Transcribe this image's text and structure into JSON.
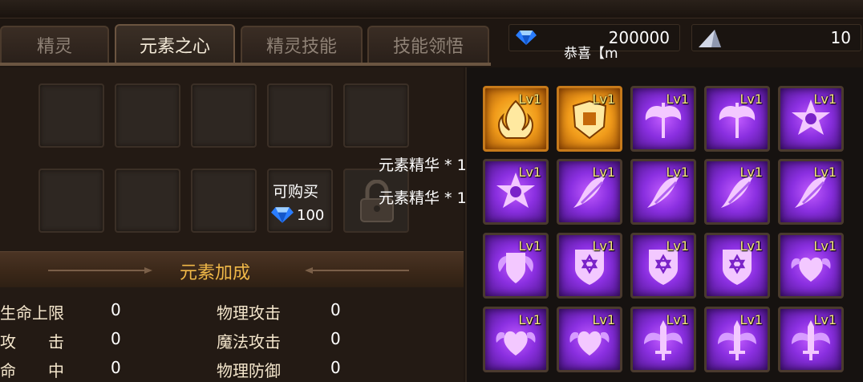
{
  "tabs": [
    {
      "label": "精灵",
      "active": false
    },
    {
      "label": "元素之心",
      "active": true
    },
    {
      "label": "精灵技能",
      "active": false
    },
    {
      "label": "技能领悟",
      "active": false
    }
  ],
  "currency": {
    "diamonds": "200000",
    "crystals": "10"
  },
  "notice": "恭喜【m",
  "shop": {
    "buy_label": "可购买",
    "price": "100"
  },
  "tooltip": [
    "元素精华 * 1",
    "元素精华 * 1"
  ],
  "bonus": {
    "title": "元素加成",
    "stats": [
      {
        "name": "生命上限",
        "value": "0"
      },
      {
        "name": "攻　　击",
        "value": "0"
      },
      {
        "name": "命　　中",
        "value": "0"
      },
      {
        "name": "物理攻击",
        "value": "0"
      },
      {
        "name": "魔法攻击",
        "value": "0"
      },
      {
        "name": "物理防御",
        "value": "0"
      }
    ]
  },
  "skills": {
    "level_label": "Lv1",
    "colors": {
      "gold": "#f09a1a",
      "purple": "#8a2fe0"
    },
    "items": [
      {
        "icon": "flame-crest-icon",
        "rarity": "gold"
      },
      {
        "icon": "armor-crest-icon",
        "rarity": "gold"
      },
      {
        "icon": "winged-axe-icon",
        "rarity": "purple"
      },
      {
        "icon": "winged-axe-icon",
        "rarity": "purple"
      },
      {
        "icon": "star-skull-icon",
        "rarity": "purple"
      },
      {
        "icon": "star-skull-icon",
        "rarity": "purple"
      },
      {
        "icon": "phoenix-icon",
        "rarity": "purple"
      },
      {
        "icon": "phoenix-icon",
        "rarity": "purple"
      },
      {
        "icon": "phoenix-icon",
        "rarity": "purple"
      },
      {
        "icon": "phoenix-icon",
        "rarity": "purple"
      },
      {
        "icon": "winged-shield-icon",
        "rarity": "purple"
      },
      {
        "icon": "hexagram-shield-icon",
        "rarity": "purple"
      },
      {
        "icon": "hexagram-shield-icon",
        "rarity": "purple"
      },
      {
        "icon": "hexagram-shield-icon",
        "rarity": "purple"
      },
      {
        "icon": "winged-heart-icon",
        "rarity": "purple"
      },
      {
        "icon": "winged-heart-icon",
        "rarity": "purple"
      },
      {
        "icon": "winged-heart-icon",
        "rarity": "purple"
      },
      {
        "icon": "winged-sword-icon",
        "rarity": "purple"
      },
      {
        "icon": "winged-sword-icon",
        "rarity": "purple"
      },
      {
        "icon": "winged-sword-icon",
        "rarity": "purple"
      }
    ]
  }
}
